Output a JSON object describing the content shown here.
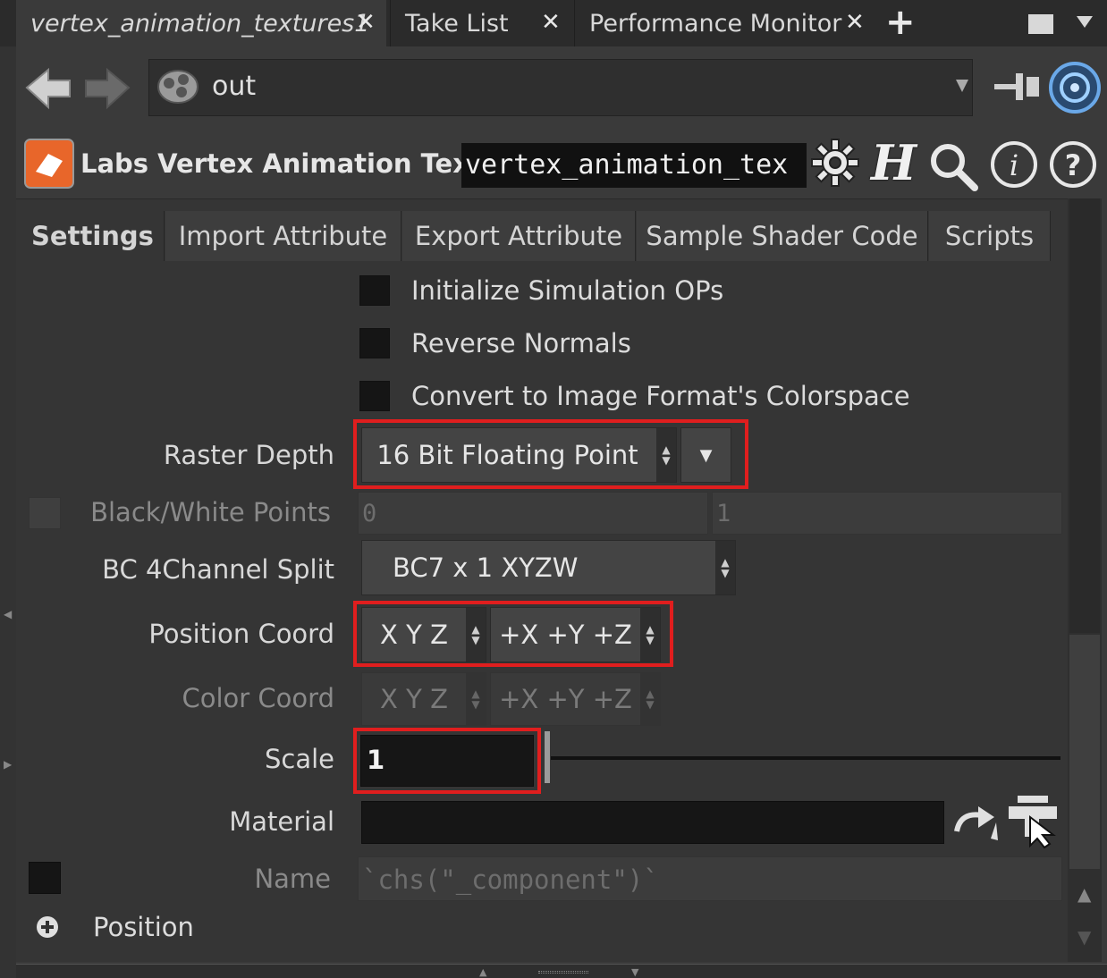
{
  "tabs": [
    {
      "label": "vertex_animation_textures1",
      "active": true
    },
    {
      "label": "Take List",
      "active": false
    },
    {
      "label": "Performance Monitor",
      "active": false
    }
  ],
  "tab_close_glyph": "✕",
  "add_tab_glyph": "+",
  "nav": {
    "path": "out",
    "back_icon": "arrow-left-icon",
    "forward_icon": "arrow-right-icon"
  },
  "node": {
    "type_label": "Labs Vertex Animation Tex...",
    "name_value": "vertex_animation_tex",
    "icons": [
      "gear-icon",
      "houdini-h-icon",
      "search-icon",
      "info-icon",
      "help-icon"
    ]
  },
  "param_tabs": [
    "Settings",
    "Import Attribute",
    "Export Attribute",
    "Sample Shader Code",
    "Scripts"
  ],
  "checkboxes": [
    {
      "label": "Initialize Simulation OPs"
    },
    {
      "label": "Reverse Normals"
    },
    {
      "label": "Convert to Image Format's Colorspace"
    }
  ],
  "raster_depth": {
    "label": "Raster Depth",
    "value": "16 Bit Floating Point"
  },
  "bw_points": {
    "label": "Black/White Points",
    "value1": "0",
    "value2": "1"
  },
  "bc_split": {
    "label": "BC 4Channel Split",
    "value": "BC7 x 1 XYZW"
  },
  "position_coord": {
    "label": "Position Coord",
    "order": "X Y Z",
    "sign": "+X +Y +Z"
  },
  "color_coord": {
    "label": "Color Coord",
    "order": "X Y Z",
    "sign": "+X +Y +Z"
  },
  "scale": {
    "label": "Scale",
    "value": "1"
  },
  "material": {
    "label": "Material",
    "value": ""
  },
  "name_param": {
    "label": "Name",
    "value": "`chs(\"_component\")`"
  },
  "position_folder": {
    "label": "Position",
    "icon": "plus-circle-icon"
  },
  "colors": {
    "highlight": "#e01e1e",
    "bg": "#3a3a3a",
    "field": "#161616",
    "accent": "#5aa0e0"
  }
}
